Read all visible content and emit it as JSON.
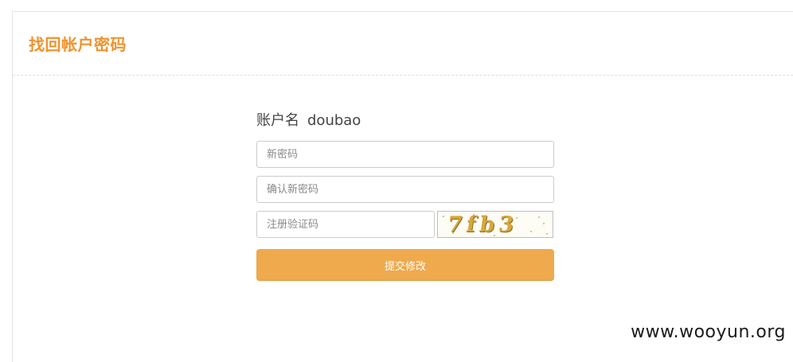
{
  "page": {
    "title": "找回帐户密码"
  },
  "form": {
    "account_label": "账户名",
    "account_value": "doubao",
    "new_password_placeholder": "新密码",
    "confirm_password_placeholder": "确认新密码",
    "captcha_placeholder": "注册验证码",
    "captcha_text": "7fb3",
    "submit_label": "提交修改"
  },
  "colors": {
    "title": "#f0932b",
    "button": "#eeaa4d",
    "captcha_text": "#d8a63c"
  },
  "watermark": "www.wooyun.org"
}
